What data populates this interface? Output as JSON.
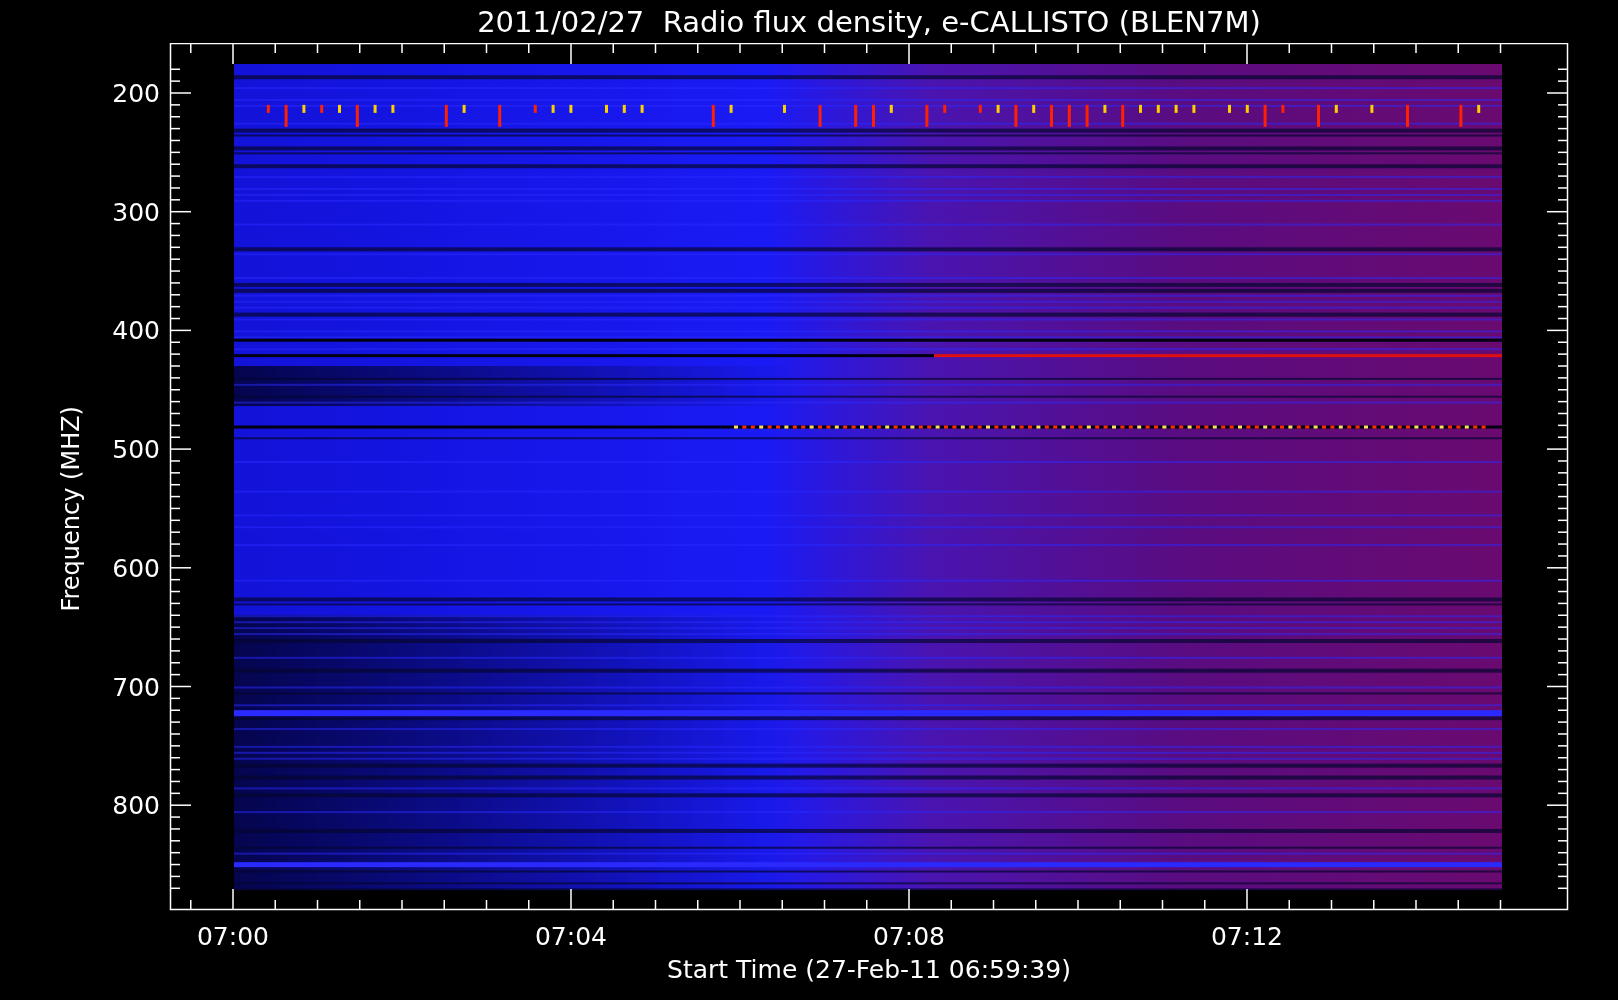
{
  "title": "2011/02/27  Radio flux density, e-CALLISTO (BLEN7M)",
  "y_axis": {
    "label": "Frequency (MHZ)",
    "ticks": [
      "200",
      "300",
      "400",
      "500",
      "600",
      "700",
      "800"
    ]
  },
  "x_axis": {
    "label": "Start Time (27-Feb-11 06:59:39)",
    "ticks": [
      "07:00",
      "07:04",
      "07:08",
      "07:12"
    ]
  }
}
